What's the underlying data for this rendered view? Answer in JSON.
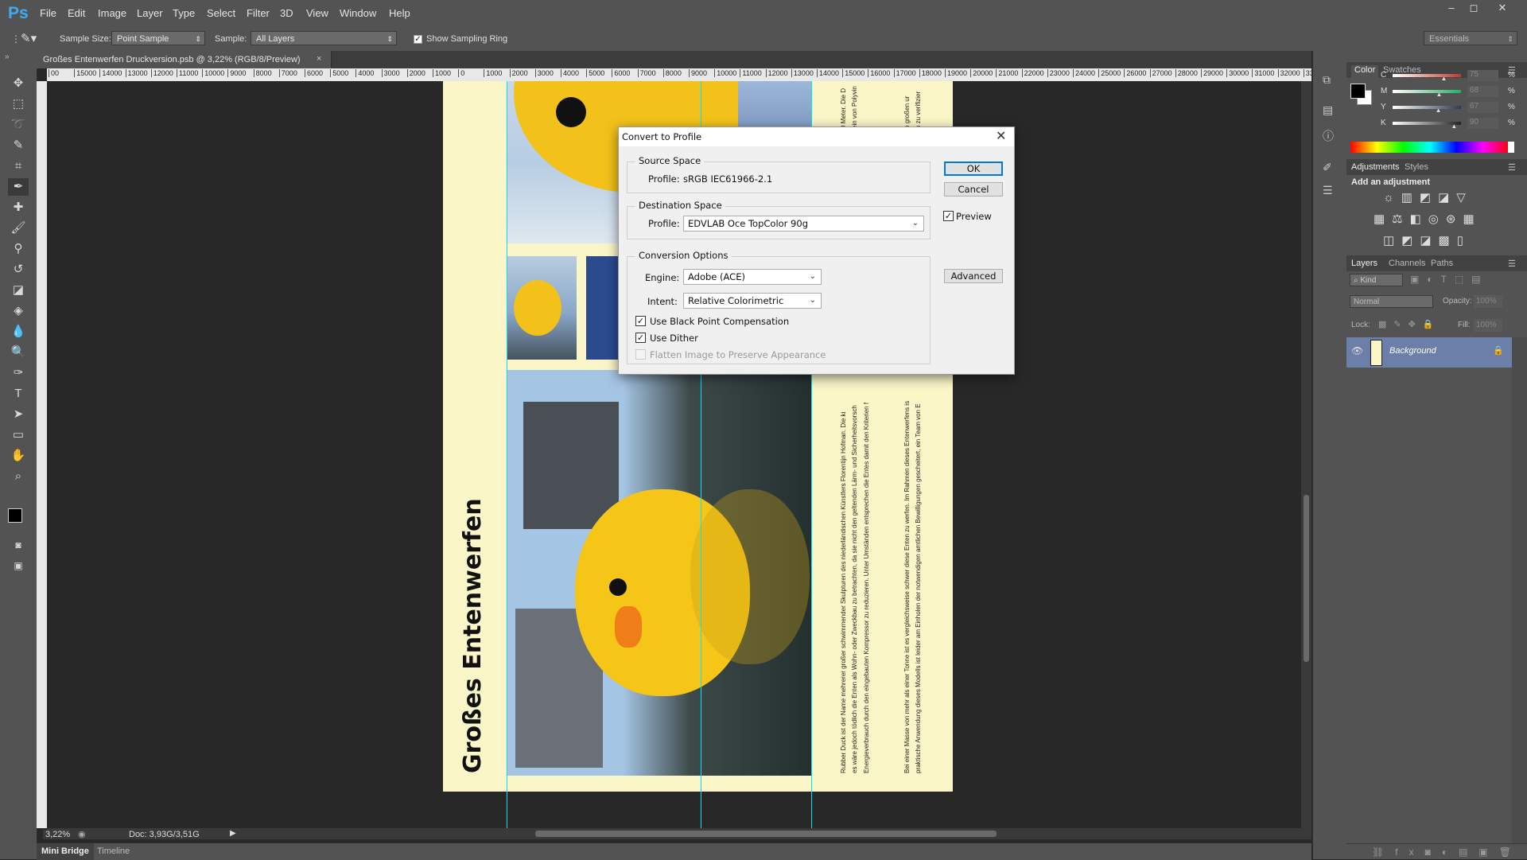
{
  "app": {
    "logo": "Ps"
  },
  "menu": [
    "File",
    "Edit",
    "Image",
    "Layer",
    "Type",
    "Select",
    "Filter",
    "3D",
    "View",
    "Window",
    "Help"
  ],
  "window_controls": [
    "–",
    "◻",
    "✕"
  ],
  "options_bar": {
    "sample_size_label": "Sample Size:",
    "sample_size_value": "Point Sample",
    "sample_label": "Sample:",
    "sample_value": "All Layers",
    "show_ring_label": "Show Sampling Ring",
    "show_ring_checked": true,
    "workspace": "Essentials"
  },
  "document": {
    "tab_title": "Großes Entenwerfen Druckversion.psb @ 3,22% (RGB/8/Preview)",
    "zoom": "3,22%",
    "doc_size": "Doc: 3,93G/3,51G",
    "poster_title": "Großes Entenwerfen",
    "column_text": [
      "Rubber Duck ist der Name mehrerer großer schwimmender Skulpturen des niederländischen Künstlers Florentijn Hofman. Die ki",
      "es wäre jedoch tödlich die Enten als Wohn- oder Zweckbau zu betrachten, da sie nicht den geltenden Lärm- und Sicherheitsvorsch",
      "Energieverbrauch durch den eingebauten Kompressor zu reduzieren. Unter Umständen entsprechen die Entes damit den Kriterien f",
      "Bei einer Masse von mehr als einer Tonne ist es vergleichsweise schwer diese Enten zu werfen. Im Rahmen dieses Entenwerfens is",
      "praktische Anwendung dieses Modells ist leider am Einholen der notwendigen amtlichen Bewilligungen gescheitert, ein Team von E"
    ],
    "column_text_top": [
      "0 Meter. Die D",
      "ein von Polyvin",
      "n großen ur",
      "n zu verifizier"
    ]
  },
  "ruler_labels": [
    "00",
    "15000",
    "14000",
    "13000",
    "12000",
    "11000",
    "10000",
    "9000",
    "8000",
    "7000",
    "6000",
    "5000",
    "4000",
    "3000",
    "2000",
    "1000",
    "0",
    "1000",
    "2000",
    "3000",
    "4000",
    "5000",
    "6000",
    "7000",
    "8000",
    "9000",
    "10000",
    "11000",
    "12000",
    "13000",
    "14000",
    "15000",
    "16000",
    "17000",
    "18000",
    "19000",
    "20000",
    "21000",
    "22000",
    "23000",
    "24000",
    "25000",
    "26000",
    "27000",
    "28000",
    "29000",
    "30000",
    "31000",
    "32000",
    "33"
  ],
  "dialog": {
    "title": "Convert to Profile",
    "source_space": {
      "legend": "Source Space",
      "profile_label": "Profile:",
      "profile_value": "sRGB IEC61966-2.1"
    },
    "destination_space": {
      "legend": "Destination Space",
      "profile_label": "Profile:",
      "profile_value": "EDVLAB Oce TopColor 90g"
    },
    "conversion_options": {
      "legend": "Conversion Options",
      "engine_label": "Engine:",
      "engine_value": "Adobe (ACE)",
      "intent_label": "Intent:",
      "intent_value": "Relative Colorimetric",
      "black_point": {
        "label": "Use Black Point Compensation",
        "checked": true
      },
      "dither": {
        "label": "Use Dither",
        "checked": true
      },
      "flatten": {
        "label": "Flatten Image to Preserve Appearance",
        "checked": false,
        "disabled": true
      }
    },
    "ok_label": "OK",
    "cancel_label": "Cancel",
    "preview_label": "Preview",
    "preview_checked": true,
    "advanced_label": "Advanced"
  },
  "color_panel": {
    "tabs": [
      "Color",
      "Swatches"
    ],
    "channels": [
      {
        "label": "C",
        "value": "75",
        "fraction": 0.75,
        "color": "#c0392b"
      },
      {
        "label": "M",
        "value": "68",
        "fraction": 0.68,
        "color": "#27ae60"
      },
      {
        "label": "Y",
        "value": "67",
        "fraction": 0.67,
        "color": "#2c3e50"
      },
      {
        "label": "K",
        "value": "90",
        "fraction": 0.9,
        "color": "#222222"
      }
    ],
    "percent": "%"
  },
  "adjustments_panel": {
    "tabs": [
      "Adjustments",
      "Styles"
    ],
    "heading": "Add an adjustment"
  },
  "layers_panel": {
    "tabs": [
      "Layers",
      "Channels",
      "Paths"
    ],
    "filter_kind": "Kind",
    "blend_mode": "Normal",
    "opacity_label": "Opacity:",
    "opacity_value": "100%",
    "lock_label": "Lock:",
    "fill_label": "Fill:",
    "fill_value": "100%",
    "layers": [
      {
        "name": "Background",
        "visible": true,
        "locked": true
      }
    ]
  },
  "bottom_tabs": [
    "Mini Bridge",
    "Timeline"
  ],
  "colors": {
    "poster_bg": "#fbf6c8",
    "duck_yellow": "#f5c518",
    "water": "#2e3a3a",
    "sky": "#9fc3e8",
    "guide": "#00e5ff",
    "layer_selected": "#6b7fa8"
  }
}
